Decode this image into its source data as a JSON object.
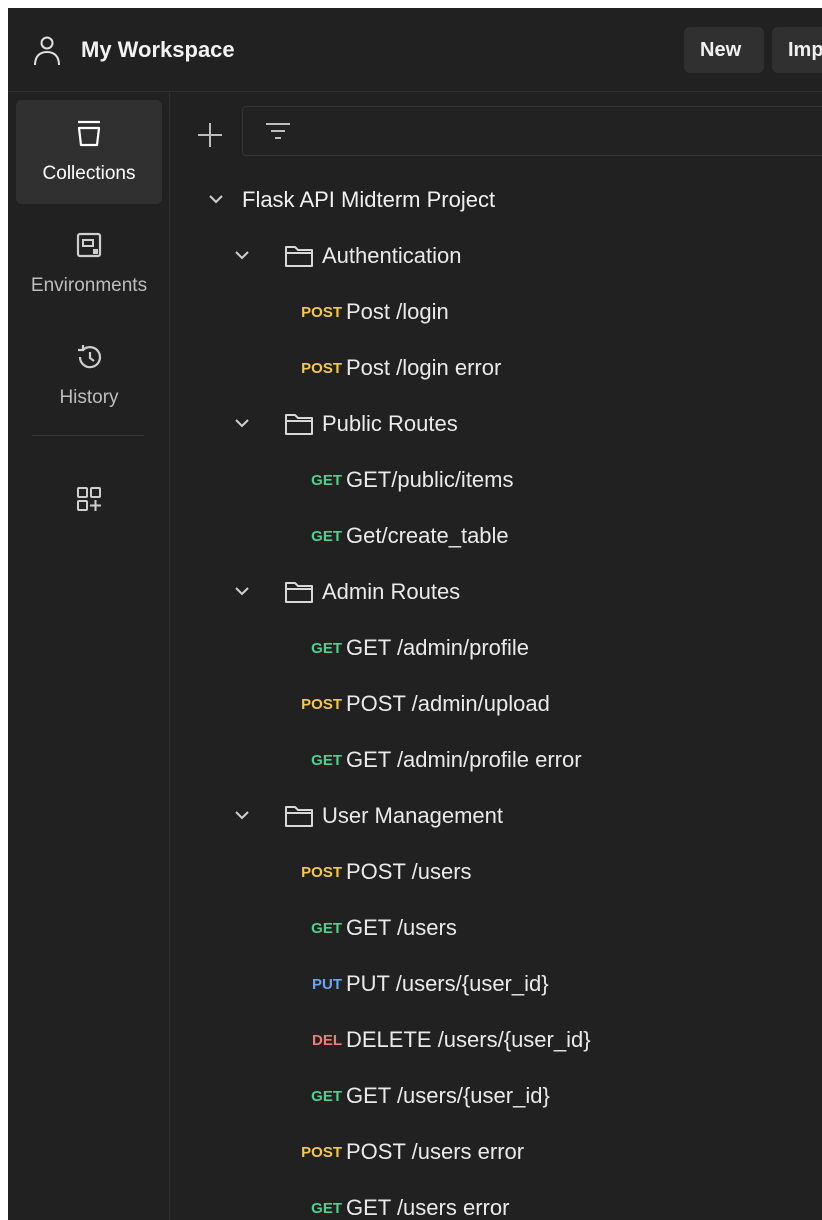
{
  "header": {
    "workspace_title": "My Workspace",
    "new_label": "New",
    "import_label": "Import"
  },
  "sidebar": {
    "items": [
      {
        "label": "Collections",
        "icon": "collections-icon",
        "active": true
      },
      {
        "label": "Environments",
        "icon": "environments-icon",
        "active": false
      },
      {
        "label": "History",
        "icon": "history-icon",
        "active": false
      }
    ],
    "extra_icon": "add-app-icon"
  },
  "toolbar": {
    "add_icon": "plus-icon",
    "filter_icon": "filter-icon"
  },
  "tree": {
    "collection": "Flask API Midterm Project",
    "folders": [
      {
        "name": "Authentication",
        "requests": [
          {
            "method": "POST",
            "name": "Post /login"
          },
          {
            "method": "POST",
            "name": "Post /login error"
          }
        ]
      },
      {
        "name": "Public Routes",
        "requests": [
          {
            "method": "GET",
            "name": "GET/public/items"
          },
          {
            "method": "GET",
            "name": "Get/create_table"
          }
        ]
      },
      {
        "name": "Admin Routes",
        "requests": [
          {
            "method": "GET",
            "name": "GET /admin/profile"
          },
          {
            "method": "POST",
            "name": "POST /admin/upload"
          },
          {
            "method": "GET",
            "name": "GET /admin/profile error"
          }
        ]
      },
      {
        "name": "User Management",
        "requests": [
          {
            "method": "POST",
            "name": "POST /users"
          },
          {
            "method": "GET",
            "name": "GET /users"
          },
          {
            "method": "PUT",
            "name": "PUT /users/{user_id}"
          },
          {
            "method": "DEL",
            "name": "DELETE /users/{user_id}"
          },
          {
            "method": "GET",
            "name": "GET /users/{user_id}"
          },
          {
            "method": "POST",
            "name": "POST /users error"
          },
          {
            "method": "GET",
            "name": "GET /users error"
          }
        ]
      }
    ]
  },
  "colors": {
    "background": "#212121",
    "post": "#f2c94c",
    "get": "#4fcf8a",
    "put": "#6aa5ef",
    "del": "#f07a7a"
  }
}
